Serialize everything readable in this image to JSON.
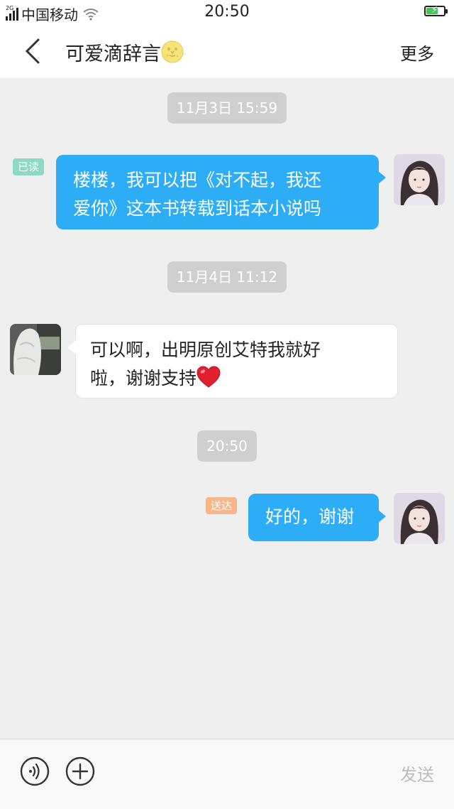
{
  "status_bar": {
    "carrier": "中国移动",
    "network_tag": "2G",
    "time": "20:50"
  },
  "header": {
    "title": "可爱滴辞言",
    "more_label": "更多"
  },
  "messages": [
    {
      "type": "timestamp",
      "text": "11月3日 15:59"
    },
    {
      "type": "outgoing",
      "badge": "已读",
      "text_line1": "楼楼，我可以把《对不起，我还",
      "text_line2": "爱你》这本书转载到话本小说吗"
    },
    {
      "type": "timestamp",
      "text": "11月4日 11:12"
    },
    {
      "type": "incoming",
      "text_line1": "可以啊，出明原创艾特我就好",
      "text_line2": "啦，谢谢支持"
    },
    {
      "type": "timestamp",
      "text": "20:50"
    },
    {
      "type": "outgoing",
      "badge": "送达",
      "text": "好的，谢谢"
    }
  ],
  "input_bar": {
    "send_label": "发送"
  },
  "colors": {
    "outgoing_bubble": "#2eadf7",
    "read_badge": "#8fd8c3",
    "delivered_badge": "#f7b68a",
    "timestamp_bg": "#cfcfcf"
  },
  "icons": [
    "back-chevron-icon",
    "moon-emoji-icon",
    "heart-emoji-icon",
    "voice-icon",
    "plus-icon",
    "wifi-icon",
    "signal-icon",
    "battery-icon"
  ]
}
